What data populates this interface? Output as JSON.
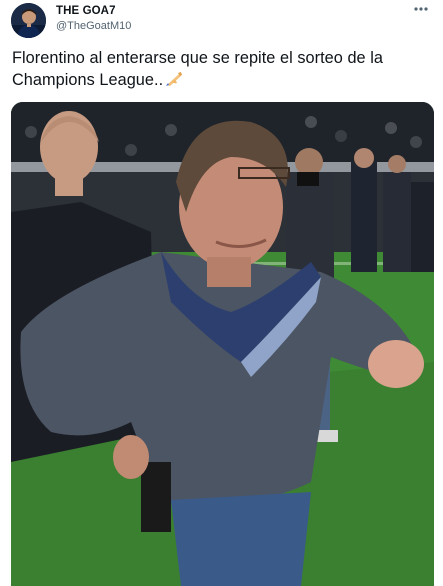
{
  "tweet": {
    "author": {
      "display_name": "THE GOA7",
      "handle": "@TheGoatM10",
      "avatar_icon": "user-avatar"
    },
    "more_icon": "more-options-icon",
    "text_line1": "Florentino al enterarse que se repite el sorteo de la",
    "text_line2": "Champions League..",
    "emoji": "writing-hand-emoji",
    "media": {
      "description_icon": "photo-attachment"
    }
  },
  "colors": {
    "text_primary": "#0f1419",
    "text_secondary": "#536471",
    "pitch_green": "#3c7a2e"
  }
}
